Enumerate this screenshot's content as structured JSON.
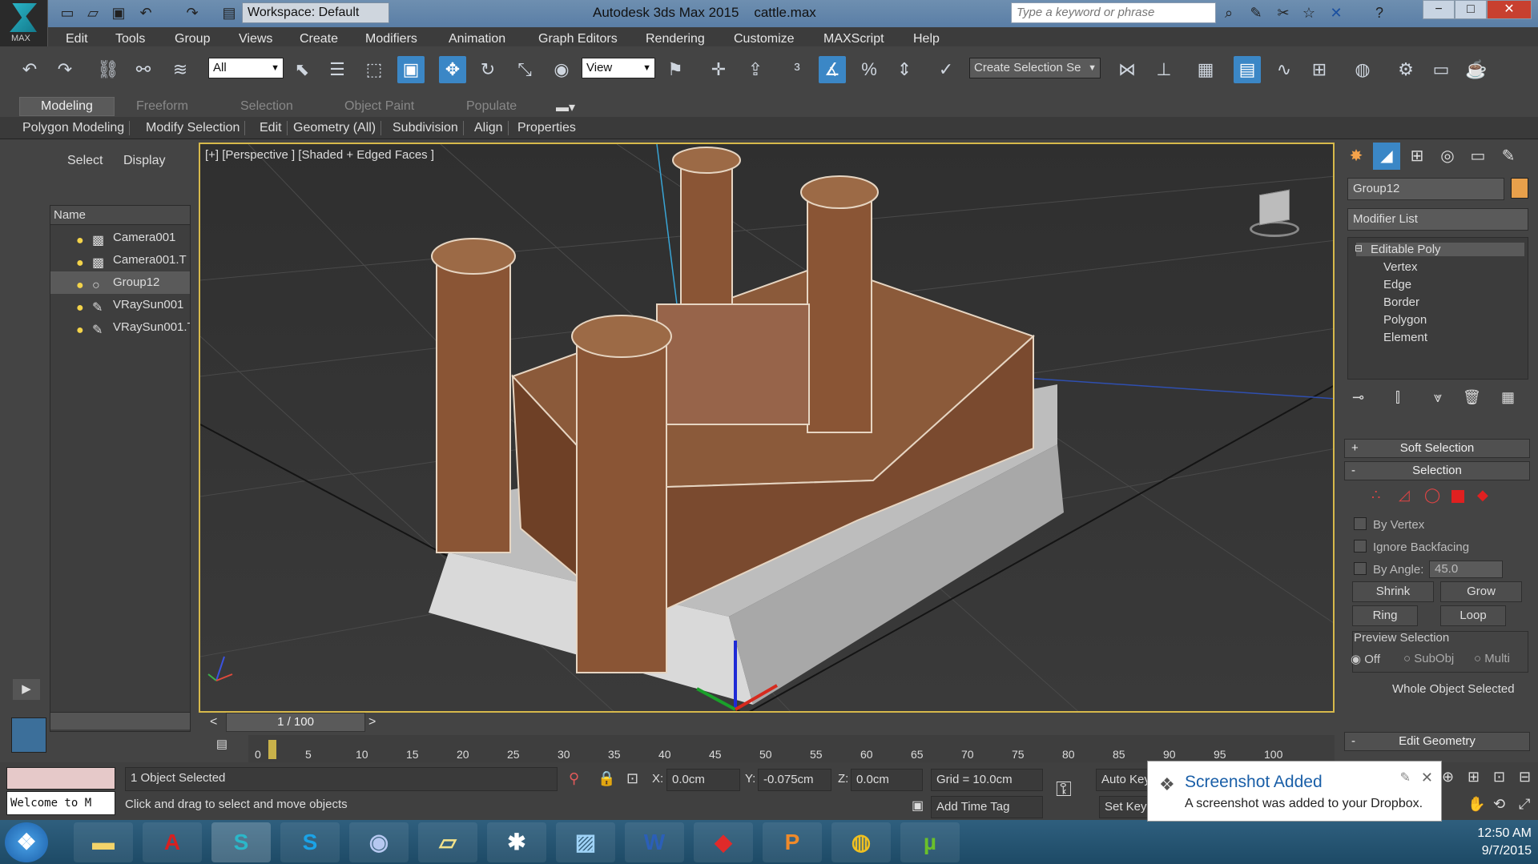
{
  "app": {
    "title": "Autodesk 3ds Max 2015",
    "file": "cattle.max",
    "logo_label": "MAX",
    "workspace": "Workspace: Default",
    "search_placeholder": "Type a keyword or phrase"
  },
  "menu": [
    "Edit",
    "Tools",
    "Group",
    "Views",
    "Create",
    "Modifiers",
    "Animation",
    "Graph Editors",
    "Rendering",
    "Customize",
    "MAXScript",
    "Help"
  ],
  "toolbar": {
    "filter": "All",
    "ref_coord": "View",
    "selection_set": "Create Selection Se"
  },
  "ribbon": {
    "tabs": [
      "Modeling",
      "Freeform",
      "Selection",
      "Object Paint",
      "Populate"
    ],
    "subtabs": [
      "Polygon Modeling",
      "Modify Selection",
      "Edit",
      "Geometry (All)",
      "Subdivision",
      "Align",
      "Properties"
    ]
  },
  "explorer": {
    "tabs": [
      "Select",
      "Display"
    ],
    "header": "Name",
    "items": [
      "Camera001",
      "Camera001.T",
      "Group12",
      "VRaySun001",
      "VRaySun001.T"
    ],
    "selected": "Group12"
  },
  "viewport": {
    "label": "[+] [Perspective ] [Shaded + Edged Faces ]"
  },
  "command_panel": {
    "object_name": "Group12",
    "object_color": "#e8a04b",
    "modifier_list": "Modifier List",
    "stack": {
      "root": "Editable Poly",
      "subs": [
        "Vertex",
        "Edge",
        "Border",
        "Polygon",
        "Element"
      ]
    },
    "rollouts": {
      "soft_selection": "Soft Selection",
      "selection": "Selection",
      "edit_geometry": "Edit Geometry"
    },
    "options": {
      "by_vertex": "By Vertex",
      "ignore_backfacing": "Ignore Backfacing",
      "by_angle": "By Angle:",
      "angle_value": "45.0"
    },
    "buttons": {
      "shrink": "Shrink",
      "grow": "Grow",
      "ring": "Ring",
      "loop": "Loop"
    },
    "preview": {
      "label": "Preview Selection",
      "off": "Off",
      "subobj": "SubObj",
      "multi": "Multi"
    },
    "status": "Whole Object Selected"
  },
  "timeline": {
    "frame": "1 / 100",
    "ticks": [
      "0",
      "5",
      "10",
      "15",
      "20",
      "25",
      "30",
      "35",
      "40",
      "45",
      "50",
      "55",
      "60",
      "65",
      "70",
      "75",
      "80",
      "85",
      "90",
      "95",
      "100"
    ],
    "prev": "<",
    "next": ">"
  },
  "status": {
    "listener": "Welcome to M",
    "selected": "1 Object Selected",
    "prompt": "Click and drag to select and move objects",
    "x_label": "X:",
    "x": "0.0cm",
    "y_label": "Y:",
    "y": "-0.075cm",
    "z_label": "Z:",
    "z": "0.0cm",
    "grid": "Grid = 10.0cm",
    "add_time_tag": "Add Time Tag",
    "auto_key": "Auto Key",
    "set_key": "Set Key"
  },
  "notification": {
    "title": "Screenshot Added",
    "message": "A screenshot was added to your Dropbox."
  },
  "clock": {
    "time": "12:50 AM",
    "date": "9/7/2015"
  }
}
